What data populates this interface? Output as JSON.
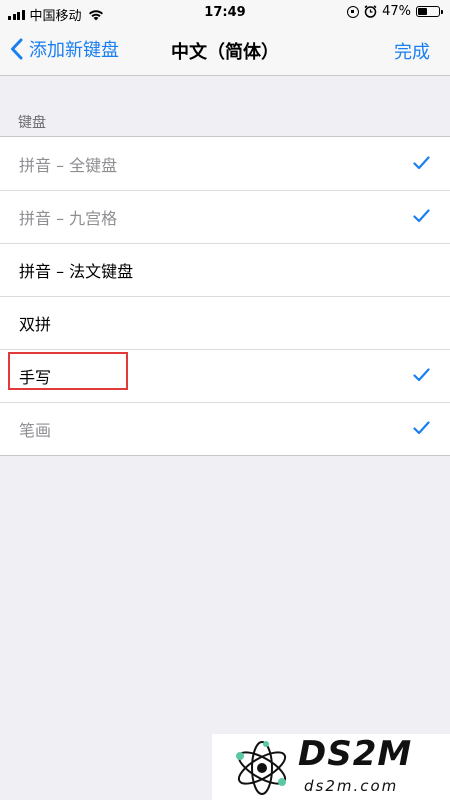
{
  "status_bar": {
    "carrier": "中国移动",
    "time": "17:49",
    "battery_percent": "47%",
    "battery_level": 0.47,
    "icons": [
      "signal-icon",
      "wifi-icon",
      "rotation-lock-icon",
      "alarm-icon",
      "battery-icon"
    ]
  },
  "nav": {
    "back_label": "添加新键盘",
    "title": "中文（简体）",
    "done_label": "完成"
  },
  "section": {
    "header": "键盘",
    "rows": [
      {
        "label": "拼音 – 全键盘",
        "checked": true,
        "enabled": false
      },
      {
        "label": "拼音 – 九宫格",
        "checked": true,
        "enabled": false
      },
      {
        "label": "拼音 – 法文键盘",
        "checked": false,
        "enabled": true
      },
      {
        "label": "双拼",
        "checked": false,
        "enabled": true
      },
      {
        "label": "手写",
        "checked": true,
        "enabled": true,
        "highlighted": true
      },
      {
        "label": "笔画",
        "checked": true,
        "enabled": false
      }
    ]
  },
  "colors": {
    "accent": "#1a7ff0",
    "highlight": "#e23a3a",
    "background": "#efeff4"
  },
  "watermark": {
    "title": "DS2M",
    "subtitle": "ds2m.com"
  }
}
